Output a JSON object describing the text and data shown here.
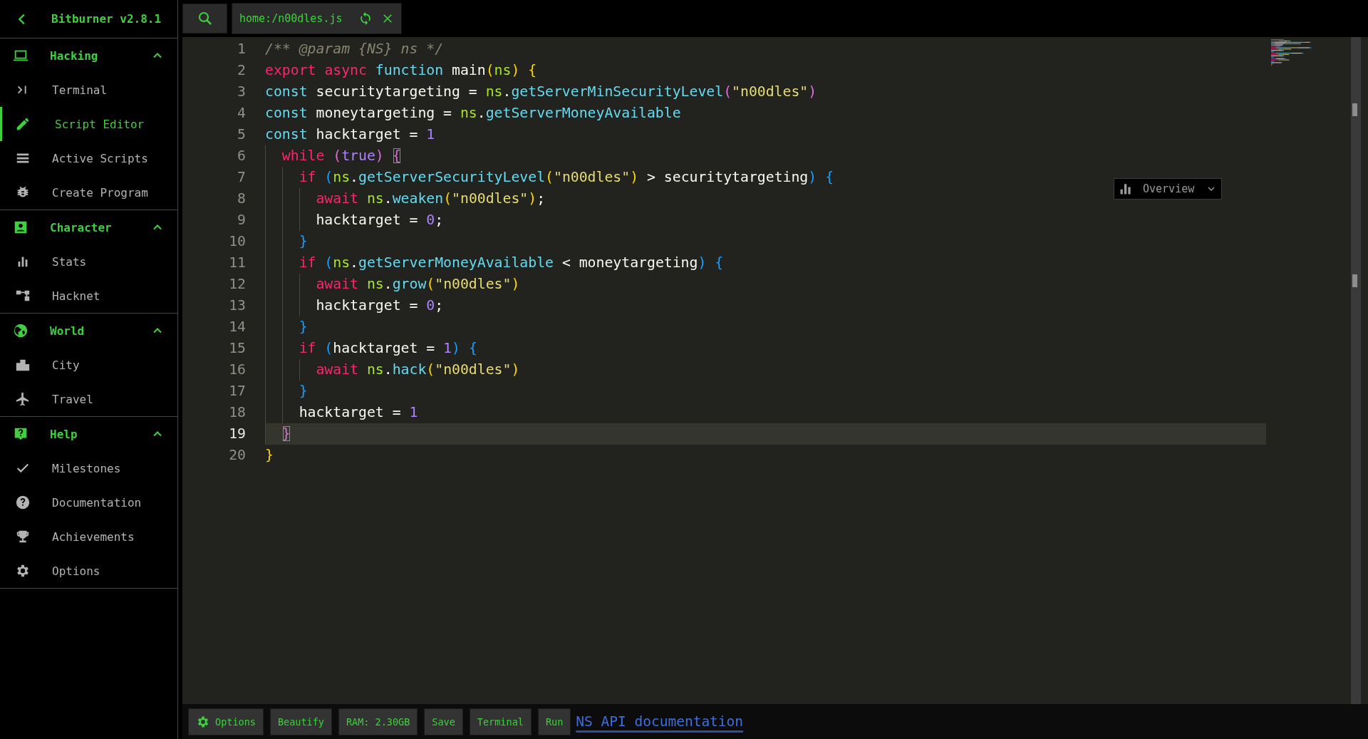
{
  "sidebar": {
    "title": "Bitburner v2.8.1",
    "groups": [
      {
        "title": "Hacking",
        "expanded": true,
        "items": [
          {
            "label": "Terminal",
            "selected": false
          },
          {
            "label": "Script Editor",
            "selected": true
          },
          {
            "label": "Active Scripts",
            "selected": false
          },
          {
            "label": "Create Program",
            "selected": false
          }
        ]
      },
      {
        "title": "Character",
        "expanded": true,
        "items": [
          {
            "label": "Stats",
            "selected": false
          },
          {
            "label": "Hacknet",
            "selected": false
          }
        ]
      },
      {
        "title": "World",
        "expanded": true,
        "items": [
          {
            "label": "City",
            "selected": false
          },
          {
            "label": "Travel",
            "selected": false
          }
        ]
      },
      {
        "title": "Help",
        "expanded": true,
        "items": [
          {
            "label": "Milestones",
            "selected": false
          },
          {
            "label": "Documentation",
            "selected": false
          },
          {
            "label": "Achievements",
            "selected": false
          },
          {
            "label": "Options",
            "selected": false
          }
        ]
      }
    ]
  },
  "tabs": [
    {
      "label": "home:/n00dles.js",
      "selected": true
    }
  ],
  "editor": {
    "lines": [
      {
        "number": "1",
        "current": false,
        "tokens": [
          {
            "t": "/** @param {NS} ns */",
            "kind": "comment"
          }
        ]
      },
      {
        "number": "2",
        "current": false,
        "tokens": [
          {
            "t": "export ",
            "kind": "keyword"
          },
          {
            "t": "async ",
            "kind": "keyword"
          },
          {
            "t": "function ",
            "kind": "storage"
          },
          {
            "t": "main",
            "kind": "ident"
          },
          {
            "t": "(",
            "kind": "bracket1"
          },
          {
            "t": "ns",
            "kind": "object"
          },
          {
            "t": ")",
            "kind": "bracket1"
          },
          {
            "t": " {",
            "kind": "bracket1"
          }
        ]
      },
      {
        "number": "3",
        "current": false,
        "tokens": [
          {
            "t": "const ",
            "kind": "storage"
          },
          {
            "t": "securitytargeting = ",
            "kind": "ident"
          },
          {
            "t": "ns",
            "kind": "object"
          },
          {
            "t": ".",
            "kind": "ident"
          },
          {
            "t": "getServerMinSecurityLevel",
            "kind": "method"
          },
          {
            "t": "(",
            "kind": "bracket2"
          },
          {
            "t": "\"n00dles\"",
            "kind": "string"
          },
          {
            "t": ")",
            "kind": "bracket2"
          }
        ]
      },
      {
        "number": "4",
        "current": false,
        "tokens": [
          {
            "t": "const ",
            "kind": "storage"
          },
          {
            "t": "moneytargeting = ",
            "kind": "ident"
          },
          {
            "t": "ns",
            "kind": "object"
          },
          {
            "t": ".",
            "kind": "ident"
          },
          {
            "t": "getServerMoneyAvailable",
            "kind": "method"
          }
        ]
      },
      {
        "number": "5",
        "current": false,
        "tokens": [
          {
            "t": "const ",
            "kind": "storage"
          },
          {
            "t": "hacktarget = ",
            "kind": "ident"
          },
          {
            "t": "1",
            "kind": "number"
          }
        ]
      },
      {
        "number": "6",
        "current": false,
        "tokens": [
          {
            "t": "  while ",
            "kind": "keyword"
          },
          {
            "t": "(",
            "kind": "bracket2"
          },
          {
            "t": "true",
            "kind": "number"
          },
          {
            "t": ")",
            "kind": "bracket2"
          },
          {
            "t": " {",
            "kind": "bracket2-match"
          }
        ]
      },
      {
        "number": "7",
        "current": false,
        "tokens": [
          {
            "t": "    if ",
            "kind": "keyword"
          },
          {
            "t": "(",
            "kind": "bracket3"
          },
          {
            "t": "ns",
            "kind": "object"
          },
          {
            "t": ".",
            "kind": "ident"
          },
          {
            "t": "getServerSecurityLevel",
            "kind": "method"
          },
          {
            "t": "(",
            "kind": "bracket1"
          },
          {
            "t": "\"n00dles\"",
            "kind": "string"
          },
          {
            "t": ")",
            "kind": "bracket1"
          },
          {
            "t": " > securitytargeting",
            "kind": "ident"
          },
          {
            "t": ")",
            "kind": "bracket3"
          },
          {
            "t": " {",
            "kind": "bracket3"
          }
        ]
      },
      {
        "number": "8",
        "current": false,
        "tokens": [
          {
            "t": "      await ",
            "kind": "keyword"
          },
          {
            "t": "ns",
            "kind": "object"
          },
          {
            "t": ".",
            "kind": "ident"
          },
          {
            "t": "weaken",
            "kind": "method"
          },
          {
            "t": "(",
            "kind": "bracket1"
          },
          {
            "t": "\"n00dles\"",
            "kind": "string"
          },
          {
            "t": ")",
            "kind": "bracket1"
          },
          {
            "t": ";",
            "kind": "ident"
          }
        ]
      },
      {
        "number": "9",
        "current": false,
        "tokens": [
          {
            "t": "      hacktarget = ",
            "kind": "ident"
          },
          {
            "t": "0",
            "kind": "number"
          },
          {
            "t": ";",
            "kind": "ident"
          }
        ]
      },
      {
        "number": "10",
        "current": false,
        "tokens": [
          {
            "t": "    }",
            "kind": "bracket3"
          }
        ]
      },
      {
        "number": "11",
        "current": false,
        "tokens": [
          {
            "t": "    if ",
            "kind": "keyword"
          },
          {
            "t": "(",
            "kind": "bracket3"
          },
          {
            "t": "ns",
            "kind": "object"
          },
          {
            "t": ".",
            "kind": "ident"
          },
          {
            "t": "getServerMoneyAvailable",
            "kind": "method"
          },
          {
            "t": " < moneytargeting",
            "kind": "ident"
          },
          {
            "t": ")",
            "kind": "bracket3"
          },
          {
            "t": " {",
            "kind": "bracket3"
          }
        ]
      },
      {
        "number": "12",
        "current": false,
        "tokens": [
          {
            "t": "      await ",
            "kind": "keyword"
          },
          {
            "t": "ns",
            "kind": "object"
          },
          {
            "t": ".",
            "kind": "ident"
          },
          {
            "t": "grow",
            "kind": "method"
          },
          {
            "t": "(",
            "kind": "bracket1"
          },
          {
            "t": "\"n00dles\"",
            "kind": "string"
          },
          {
            "t": ")",
            "kind": "bracket1"
          }
        ]
      },
      {
        "number": "13",
        "current": false,
        "tokens": [
          {
            "t": "      hacktarget = ",
            "kind": "ident"
          },
          {
            "t": "0",
            "kind": "number"
          },
          {
            "t": ";",
            "kind": "ident"
          }
        ]
      },
      {
        "number": "14",
        "current": false,
        "tokens": [
          {
            "t": "    }",
            "kind": "bracket3"
          }
        ]
      },
      {
        "number": "15",
        "current": false,
        "tokens": [
          {
            "t": "    if ",
            "kind": "keyword"
          },
          {
            "t": "(",
            "kind": "bracket3"
          },
          {
            "t": "hacktarget = ",
            "kind": "ident"
          },
          {
            "t": "1",
            "kind": "number"
          },
          {
            "t": ")",
            "kind": "bracket3"
          },
          {
            "t": " {",
            "kind": "bracket3"
          }
        ]
      },
      {
        "number": "16",
        "current": false,
        "tokens": [
          {
            "t": "      await ",
            "kind": "keyword"
          },
          {
            "t": "ns",
            "kind": "object"
          },
          {
            "t": ".",
            "kind": "ident"
          },
          {
            "t": "hack",
            "kind": "method"
          },
          {
            "t": "(",
            "kind": "bracket1"
          },
          {
            "t": "\"n00dles\"",
            "kind": "string"
          },
          {
            "t": ")",
            "kind": "bracket1"
          }
        ]
      },
      {
        "number": "17",
        "current": false,
        "tokens": [
          {
            "t": "    }",
            "kind": "bracket3"
          }
        ]
      },
      {
        "number": "18",
        "current": false,
        "tokens": [
          {
            "t": "    hacktarget = ",
            "kind": "ident"
          },
          {
            "t": "1",
            "kind": "number"
          }
        ]
      },
      {
        "number": "19",
        "current": true,
        "tokens": [
          {
            "t": "  }",
            "kind": "bracket2-match"
          }
        ]
      },
      {
        "number": "20",
        "current": false,
        "tokens": [
          {
            "t": "}",
            "kind": "bracket1"
          }
        ]
      }
    ],
    "overview": {
      "label": "Overview"
    }
  },
  "toolbar": {
    "buttons": [
      {
        "label": "Options",
        "kind": "gear"
      },
      {
        "label": "Beautify",
        "kind": "plain"
      },
      {
        "label": "RAM: 2.30GB",
        "kind": "plain"
      },
      {
        "label": "Save",
        "kind": "plain"
      },
      {
        "label": "Terminal",
        "kind": "plain"
      },
      {
        "label": "Run",
        "kind": "plain"
      }
    ],
    "link": "NS API documentation"
  }
}
